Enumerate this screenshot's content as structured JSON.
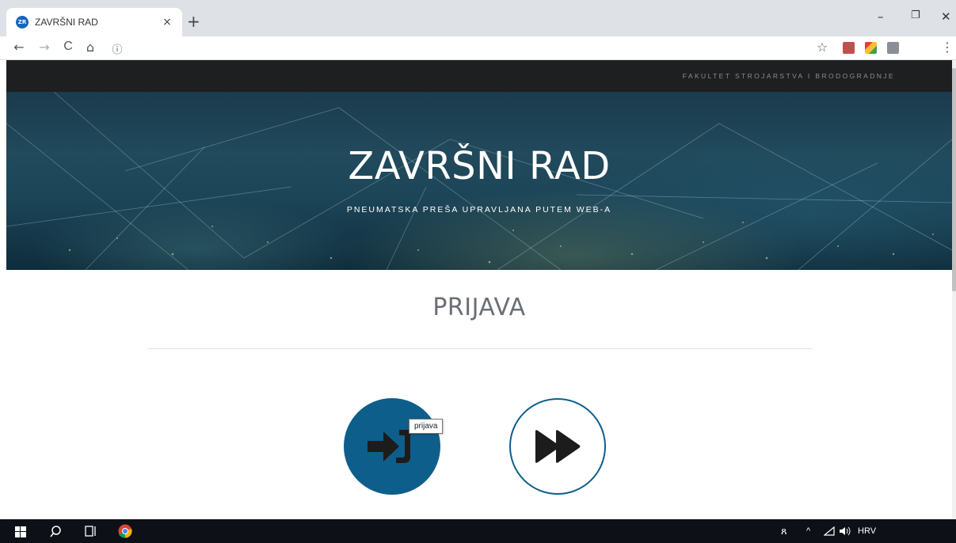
{
  "browser": {
    "tab_title": "ZAVRŠNI RAD",
    "favicon_text": "ZR",
    "tab_close": "×",
    "new_tab": "+",
    "minimize": "–",
    "restore": "❐",
    "close": "✕",
    "back": "←",
    "forward": "→",
    "reload": "C",
    "home": "⌂",
    "info": "ⓘ",
    "bookmark": "☆",
    "menu": "⋮"
  },
  "page": {
    "topnav_text": "FAKULTET STROJARSTVA I BRODOGRADNJE",
    "hero_title": "ZAVRŠNI RAD",
    "hero_subtitle": "PNEUMATSKA PREŠA UPRAVLJANA PUTEM WEB-A",
    "section_title": "PRIJAVA",
    "tooltip": "prijava",
    "accent_color": "#0e5e8c"
  },
  "taskbar": {
    "start_icon": "windows-icon",
    "search_icon": "search-icon",
    "taskview_icon": "task-view-icon",
    "chrome_icon": "chrome-icon",
    "tray_people": "ጸ",
    "tray_chevron": "^",
    "tray_network": "network-icon",
    "tray_volume": "volume-icon",
    "language": "HRV"
  }
}
